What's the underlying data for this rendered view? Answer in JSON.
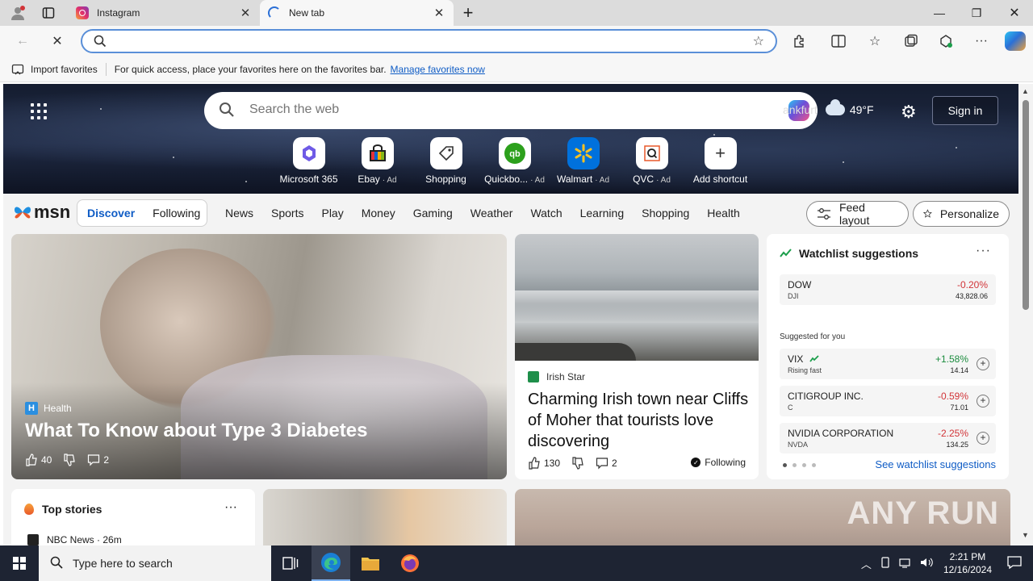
{
  "browser": {
    "tabs": [
      {
        "title": "Instagram",
        "favicon": "instagram-icon",
        "active": false
      },
      {
        "title": "New tab",
        "favicon": "loading-icon",
        "active": true
      }
    ],
    "address": {
      "value": "",
      "placeholder": ""
    },
    "favorites_bar": {
      "import_label": "Import favorites",
      "hint": "For quick access, place your favorites here on the favorites bar.",
      "manage_link": "Manage favorites now"
    }
  },
  "hero": {
    "search_placeholder": "Search the web",
    "weather": {
      "city": "ankfurt",
      "temp": "49°F"
    },
    "sign_in": "Sign in",
    "shortcuts": [
      {
        "label": "Microsoft 365",
        "ad": "",
        "icon": "m365-icon"
      },
      {
        "label": "Ebay",
        "ad": "· Ad",
        "icon": "ebay-icon"
      },
      {
        "label": "Shopping",
        "ad": "",
        "icon": "shopping-tag-icon"
      },
      {
        "label": "Quickbo...",
        "ad": "· Ad",
        "icon": "quickbooks-icon"
      },
      {
        "label": "Walmart",
        "ad": "· Ad",
        "icon": "walmart-icon"
      },
      {
        "label": "QVC",
        "ad": "· Ad",
        "icon": "qvc-icon"
      },
      {
        "label": "Add shortcut",
        "ad": "",
        "icon": "plus-icon"
      }
    ]
  },
  "msn": {
    "logo": "msn",
    "primary_tabs": {
      "discover": "Discover",
      "following": "Following"
    },
    "nav": [
      "News",
      "Sports",
      "Play",
      "Money",
      "Gaming",
      "Weather",
      "Watch",
      "Learning",
      "Shopping",
      "Health"
    ],
    "feed_layout": "Feed layout",
    "personalize": "Personalize"
  },
  "main_story": {
    "category": "Health",
    "category_badge": "H",
    "title": "What To Know about Type 3 Diabetes",
    "likes": "40",
    "comments": "2"
  },
  "side_story": {
    "source": "Irish Star",
    "title": "Charming Irish town near Cliffs of Moher that tourists love discovering",
    "likes": "130",
    "comments": "2",
    "following": "Following"
  },
  "watchlist": {
    "title": "Watchlist suggestions",
    "main": {
      "name": "DOW",
      "ticker": "DJI",
      "change": "-0.20%",
      "price": "43,828.06"
    },
    "suggested_label": "Suggested for you",
    "suggested": [
      {
        "name": "VIX",
        "ticker": "Rising fast",
        "change": "+1.58%",
        "price": "14.14",
        "trend": "up"
      },
      {
        "name": "CITIGROUP INC.",
        "ticker": "C",
        "change": "-0.59%",
        "price": "71.01",
        "trend": "down"
      },
      {
        "name": "NVIDIA CORPORATION",
        "ticker": "NVDA",
        "change": "-2.25%",
        "price": "134.25",
        "trend": "down"
      }
    ],
    "see_link": "See watchlist suggestions"
  },
  "top_stories": {
    "title": "Top stories",
    "first_source": "NBC News · 26m"
  },
  "watermark": "ANY RUN",
  "taskbar": {
    "search_placeholder": "Type here to search",
    "time": "2:21 PM",
    "date": "12/16/2024"
  },
  "colors": {
    "accent": "#0f5cc5",
    "negative": "#d13438",
    "positive": "#1b8c3e",
    "taskbar": "#1e2433"
  }
}
